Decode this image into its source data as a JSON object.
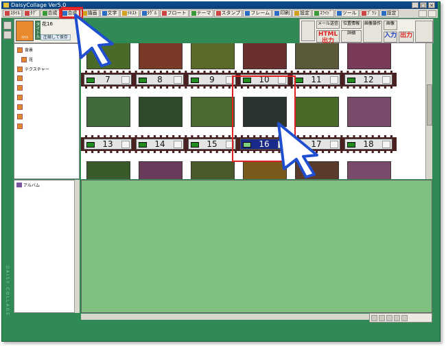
{
  "window": {
    "title": "DaisyCollage Ver5.0"
  },
  "toolbar": {
    "buttons": [
      "ｽﾀｲﾙ",
      "ﾀｸﾞ",
      "合成",
      "合成",
      "描画",
      "文字",
      "ﾃｷｽﾄ",
      "ﾀｸﾞﾙ",
      "フロート",
      "テーマ",
      "スタンプ",
      "フレーム",
      "印刷",
      "設定",
      "ｽﾗｲﾄﾞ",
      "ツール",
      "ﾌﾞﾗｼ",
      "設定"
    ]
  },
  "tree": {
    "name": "花16",
    "compress_label": "圧縮して保存",
    "tab_label": "タイトル",
    "icon_label": "ｽﾀｲﾙ",
    "nodes": [
      "背景",
      "花",
      "テクスチャー"
    ]
  },
  "album": {
    "label": "アルバム"
  },
  "frames": {
    "row1": [
      "7",
      "8",
      "9",
      "10",
      "11",
      "12"
    ],
    "row2": [
      "13",
      "14",
      "15",
      "16",
      "17",
      "18"
    ],
    "selected": "16"
  },
  "right_tools": {
    "mail": "メール送信",
    "html": "HTML出力",
    "position": "位置情報",
    "detail": "詳細",
    "image": "画像",
    "input": "入力",
    "output": "出力",
    "image_op": "画像操作"
  },
  "side": {
    "vertical_text": "DAISY COLLAGE"
  },
  "colors": {
    "accent": "#2f8a56",
    "selection": "#1a2a8a",
    "highlight": "#e02020"
  }
}
